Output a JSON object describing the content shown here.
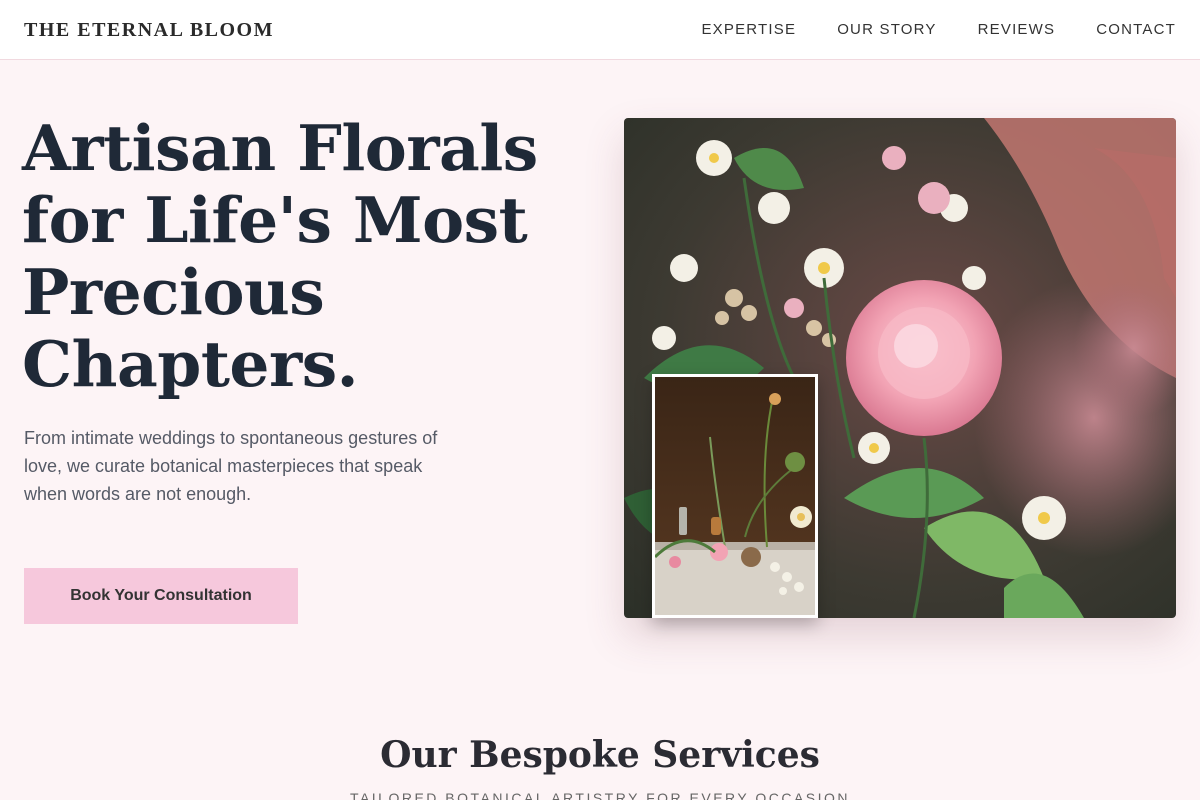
{
  "brand": {
    "name": "THE ETERNAL BLOOM"
  },
  "nav": {
    "items": [
      {
        "label": "EXPERTISE"
      },
      {
        "label": "OUR STORY"
      },
      {
        "label": "REVIEWS"
      },
      {
        "label": "CONTACT"
      }
    ]
  },
  "hero": {
    "title": "Artisan Florals for Life's Most Precious Chapters.",
    "subtitle": "From intimate weddings to spontaneous gestures of love, we curate botanical masterpieces that speak when words are not enough.",
    "cta_label": "Book Your Consultation"
  },
  "services": {
    "title": "Our Bespoke Services",
    "subtitle": "TAILORED BOTANICAL ARTISTRY FOR EVERY OCCASION"
  },
  "colors": {
    "page_background": "#fdf4f6",
    "cta_background": "#f6c8dc",
    "heading": "#1f2937",
    "accent_pink": "#f2a7b8"
  }
}
